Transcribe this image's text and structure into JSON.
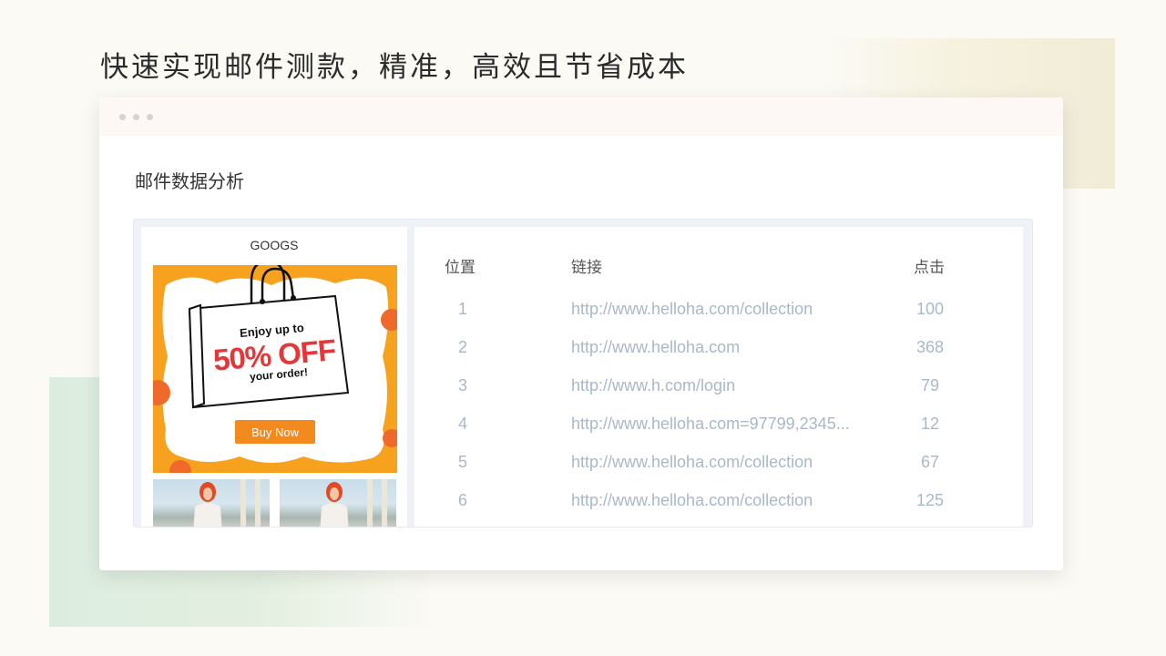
{
  "headline": "快速实现邮件测款，精准，高效且节省成本",
  "panel": {
    "title": "邮件数据分析"
  },
  "email_preview": {
    "brand": "GOOGS",
    "promo_line1": "Enjoy up to",
    "promo_discount": "50% OFF",
    "promo_line2": "your order!",
    "cta_label": "Buy Now"
  },
  "table": {
    "headers": {
      "position": "位置",
      "link": "链接",
      "clicks": "点击"
    },
    "rows": [
      {
        "position": "1",
        "link": "http://www.helloha.com/collection",
        "clicks": "100"
      },
      {
        "position": "2",
        "link": "http://www.helloha.com",
        "clicks": "368"
      },
      {
        "position": "3",
        "link": "http://www.h.com/login",
        "clicks": "79"
      },
      {
        "position": "4",
        "link": "http://www.helloha.com=97799,2345...",
        "clicks": "12"
      },
      {
        "position": "5",
        "link": "http://www.helloha.com/collection",
        "clicks": "67"
      },
      {
        "position": "6",
        "link": "http://www.helloha.com/collection",
        "clicks": "125"
      }
    ]
  },
  "colors": {
    "banner_orange": "#fbbd2c",
    "button_orange": "#f28a1d",
    "discount_red": "#e4373a",
    "table_value": "#a9b8c9"
  }
}
